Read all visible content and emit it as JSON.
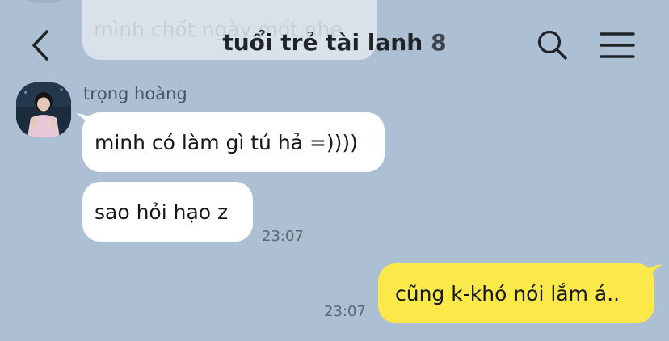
{
  "ghost": {
    "prev_message": "mình chốt ngày mốt nhe"
  },
  "header": {
    "title": "tuổi trẻ tài lanh",
    "member_count": "8"
  },
  "messages": [
    {
      "sender": "trọng hoàng",
      "direction": "incoming",
      "text": "minh có làm gì tú hả =))))"
    },
    {
      "direction": "incoming",
      "text": "sao hỏi hạo z",
      "time": "23:07"
    },
    {
      "direction": "outgoing",
      "text": "cũng k-khó nói lắm á..",
      "time": "23:07"
    }
  ],
  "colors": {
    "background": "#acbfd3",
    "incoming_bubble": "#ffffff",
    "outgoing_bubble": "#fbe94a"
  },
  "icons": {
    "back": "chevron-left-icon",
    "search": "search-icon",
    "menu": "hamburger-menu-icon"
  }
}
